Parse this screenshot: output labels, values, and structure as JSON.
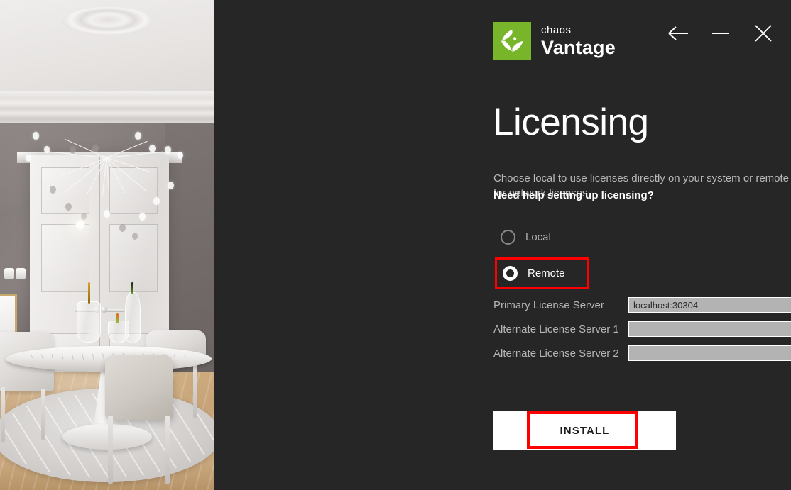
{
  "window": {
    "controls": [
      {
        "name": "back-button",
        "icon": "arrow-left-icon",
        "label": "Back"
      },
      {
        "name": "minimize-button",
        "icon": "minimize-icon",
        "label": "Minimize"
      },
      {
        "name": "close-button",
        "icon": "close-icon",
        "label": "Close"
      }
    ]
  },
  "brand": {
    "icon": "chaos-logo-icon",
    "company": "chaos",
    "product": "Vantage",
    "accent_green": "#79b52b"
  },
  "page": {
    "title": "Licensing",
    "description": "Choose local to use licenses directly on your system or remote for network licenses.",
    "help_link": "Need help setting up licensing?"
  },
  "license_mode": {
    "selected": "Remote",
    "options": [
      {
        "label": "Local",
        "selected": false,
        "highlighted": false
      },
      {
        "label": "Remote",
        "selected": true,
        "highlighted": true
      }
    ]
  },
  "servers": {
    "fields": [
      {
        "label": "Primary License Server",
        "value": "localhost:30304",
        "placeholder": ""
      },
      {
        "label": "Alternate License Server 1",
        "value": "",
        "placeholder": ""
      },
      {
        "label": "Alternate License Server 2",
        "value": "",
        "placeholder": ""
      }
    ]
  },
  "actions": {
    "install_label": "INSTALL",
    "install_highlighted": true,
    "highlight_color": "#ff0000"
  },
  "hero": {
    "alt": "Interior dining room render with branch chandelier, marble tulip table, white chairs, round rug and panelled doors"
  }
}
